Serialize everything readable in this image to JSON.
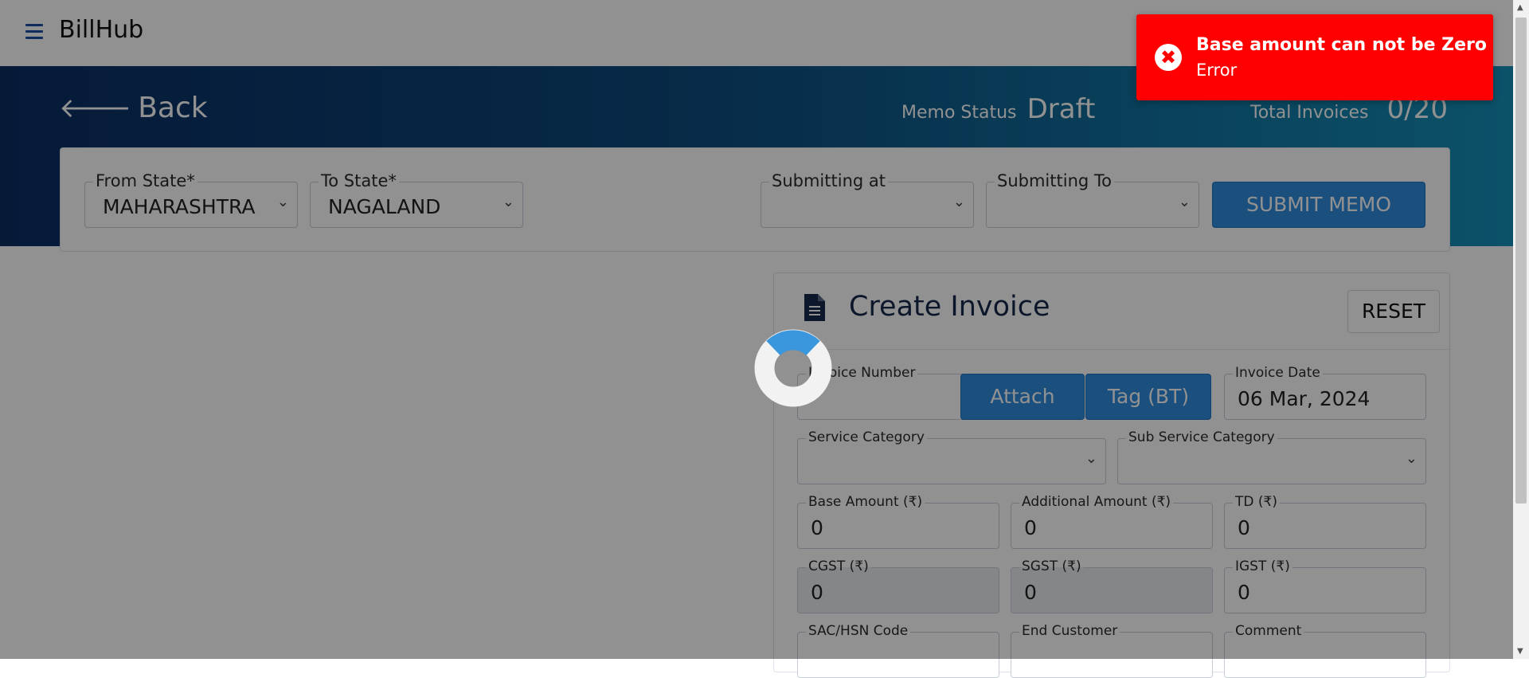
{
  "app": {
    "title": "BillHub",
    "menu_icon": "hamburger-menu-icon"
  },
  "banner": {
    "back_label": "Back",
    "memo_status_label": "Memo Status",
    "memo_status_value": "Draft",
    "total_invoices_label": "Total Invoices",
    "total_invoices_value": "0/20"
  },
  "memo_form": {
    "from_state_label": "From State*",
    "from_state_value": "MAHARASHTRA",
    "to_state_label": "To State*",
    "to_state_value": "NAGALAND",
    "submitting_at_label": "Submitting at",
    "submitting_at_value": "",
    "submitting_to_label": "Submitting To",
    "submitting_to_value": "",
    "submit_label": "SUBMIT MEMO"
  },
  "invoice": {
    "title": "Create Invoice",
    "reset_label": "RESET",
    "invoice_number_label": "Invoice Number",
    "invoice_number_value": "",
    "attach_label": "Attach",
    "tag_label": "Tag (BT)",
    "invoice_date_label": "Invoice Date",
    "invoice_date_value": "06 Mar, 2024",
    "service_category_label": "Service Category",
    "sub_service_category_label": "Sub Service Category",
    "base_amount_label": "Base Amount (₹)",
    "base_amount_value": "0",
    "additional_amount_label": "Additional Amount (₹)",
    "additional_amount_value": "0",
    "td_label": "TD (₹)",
    "td_value": "0",
    "cgst_label": "CGST (₹)",
    "cgst_value": "0",
    "sgst_label": "SGST (₹)",
    "sgst_value": "0",
    "igst_label": "IGST (₹)",
    "igst_value": "0",
    "sac_label": "SAC/HSN Code",
    "end_customer_label": "End Customer",
    "comment_label": "Comment"
  },
  "toast": {
    "title": "Base amount can not be Zero",
    "message": "Error",
    "color": "#ff0000"
  },
  "colors": {
    "accent": "#2f8cde",
    "banner_start": "#0b2e63",
    "banner_end": "#1590b8",
    "spinner_accent": "#3a96dd"
  }
}
